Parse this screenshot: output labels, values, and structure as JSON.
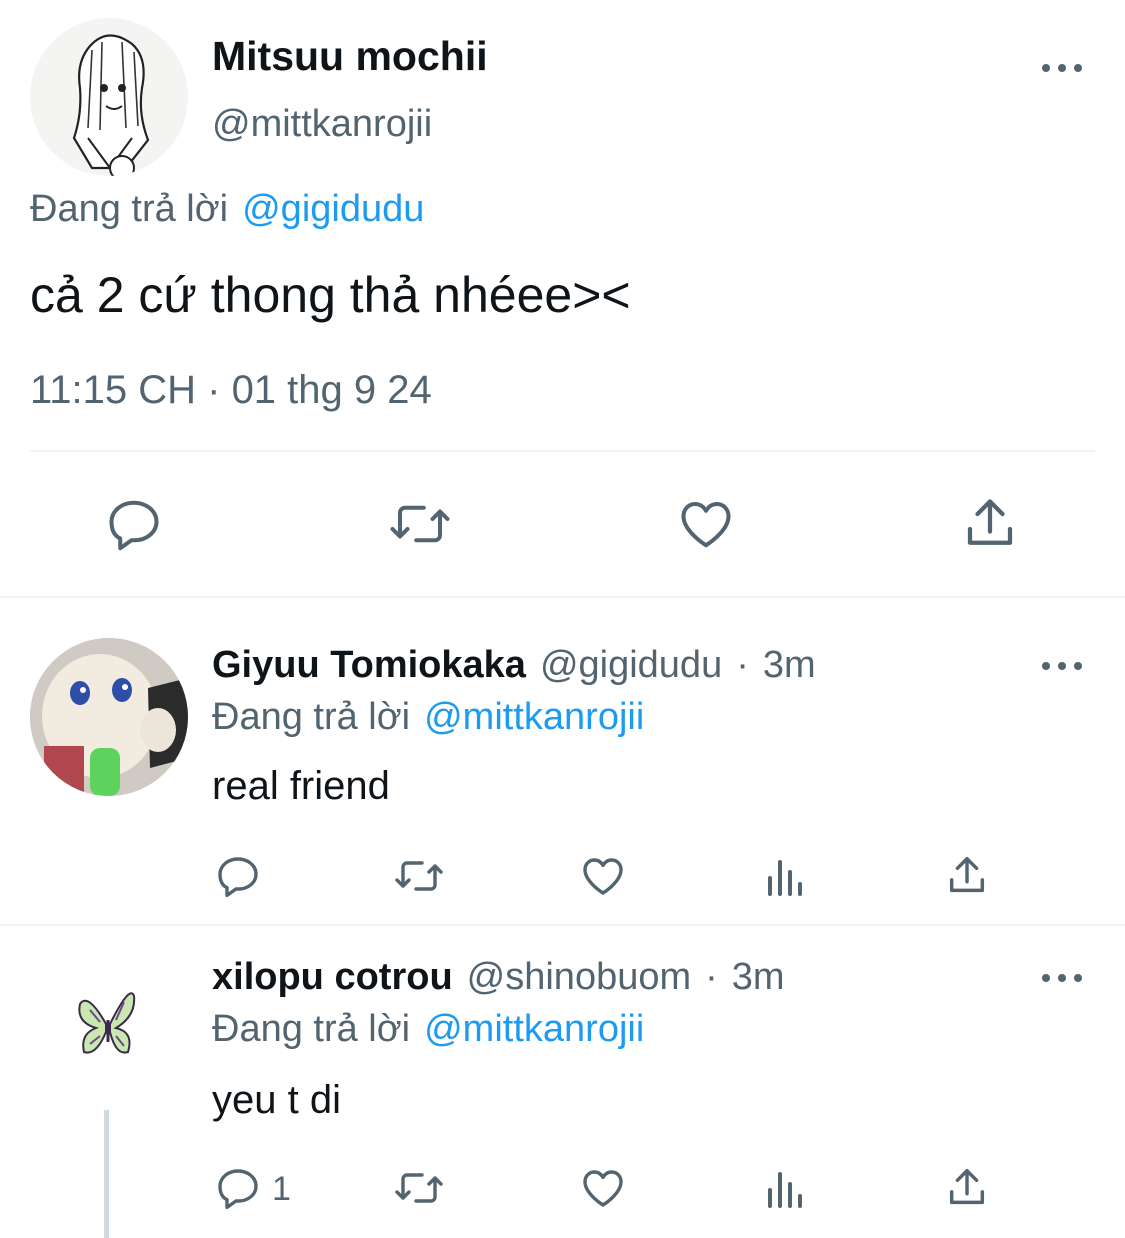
{
  "main_tweet": {
    "display_name": "Mitsuu mochii",
    "handle": "@mittkanrojii",
    "replying_prefix": "Đang trả lời",
    "replying_to": "@gigidudu",
    "text": "cả 2 cứ thong thả nhéee><",
    "timestamp": "11:15 CH · 01 thg 9 24",
    "actions": [
      "reply-icon",
      "retweet-icon",
      "like-icon",
      "share-icon"
    ]
  },
  "replies": [
    {
      "display_name": "Giyuu Tomiokaka",
      "handle": "@gigidudu",
      "separator": "·",
      "time": "3m",
      "replying_prefix": "Đang trả lời",
      "replying_to": "@mittkanrojii",
      "text": "real friend",
      "reply_count": "",
      "actions": [
        "reply-icon",
        "retweet-icon",
        "like-icon",
        "views-icon",
        "share-icon"
      ]
    },
    {
      "display_name": "xilopu cotrou",
      "handle": "@shinobuom",
      "separator": "·",
      "time": "3m",
      "replying_prefix": "Đang trả lời",
      "replying_to": "@mittkanrojii",
      "text": "yeu t di",
      "reply_count": "1",
      "actions": [
        "reply-icon",
        "retweet-icon",
        "like-icon",
        "views-icon",
        "share-icon"
      ]
    }
  ],
  "colors": {
    "link": "#1d9bf0",
    "muted": "#536471",
    "text": "#0f1419",
    "divider": "#eff3f4"
  }
}
